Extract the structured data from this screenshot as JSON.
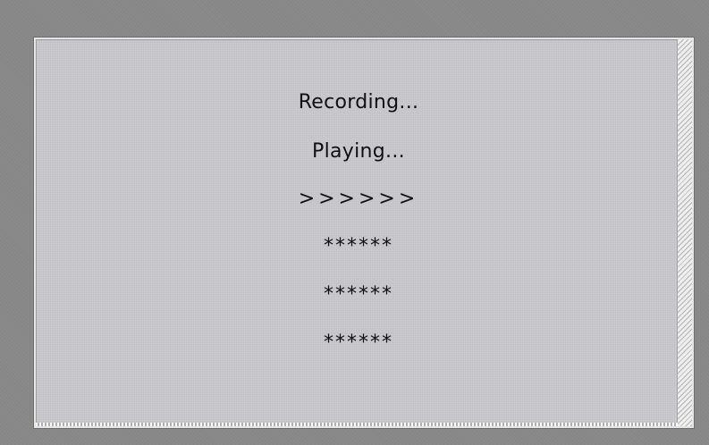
{
  "status": {
    "lines": [
      "Recording...",
      "Playing...",
      ">>>>>>",
      "******",
      "******",
      "******"
    ]
  },
  "colors": {
    "background": "#8a8a8a",
    "panel": "#c7c7cc",
    "text": "#111111"
  }
}
